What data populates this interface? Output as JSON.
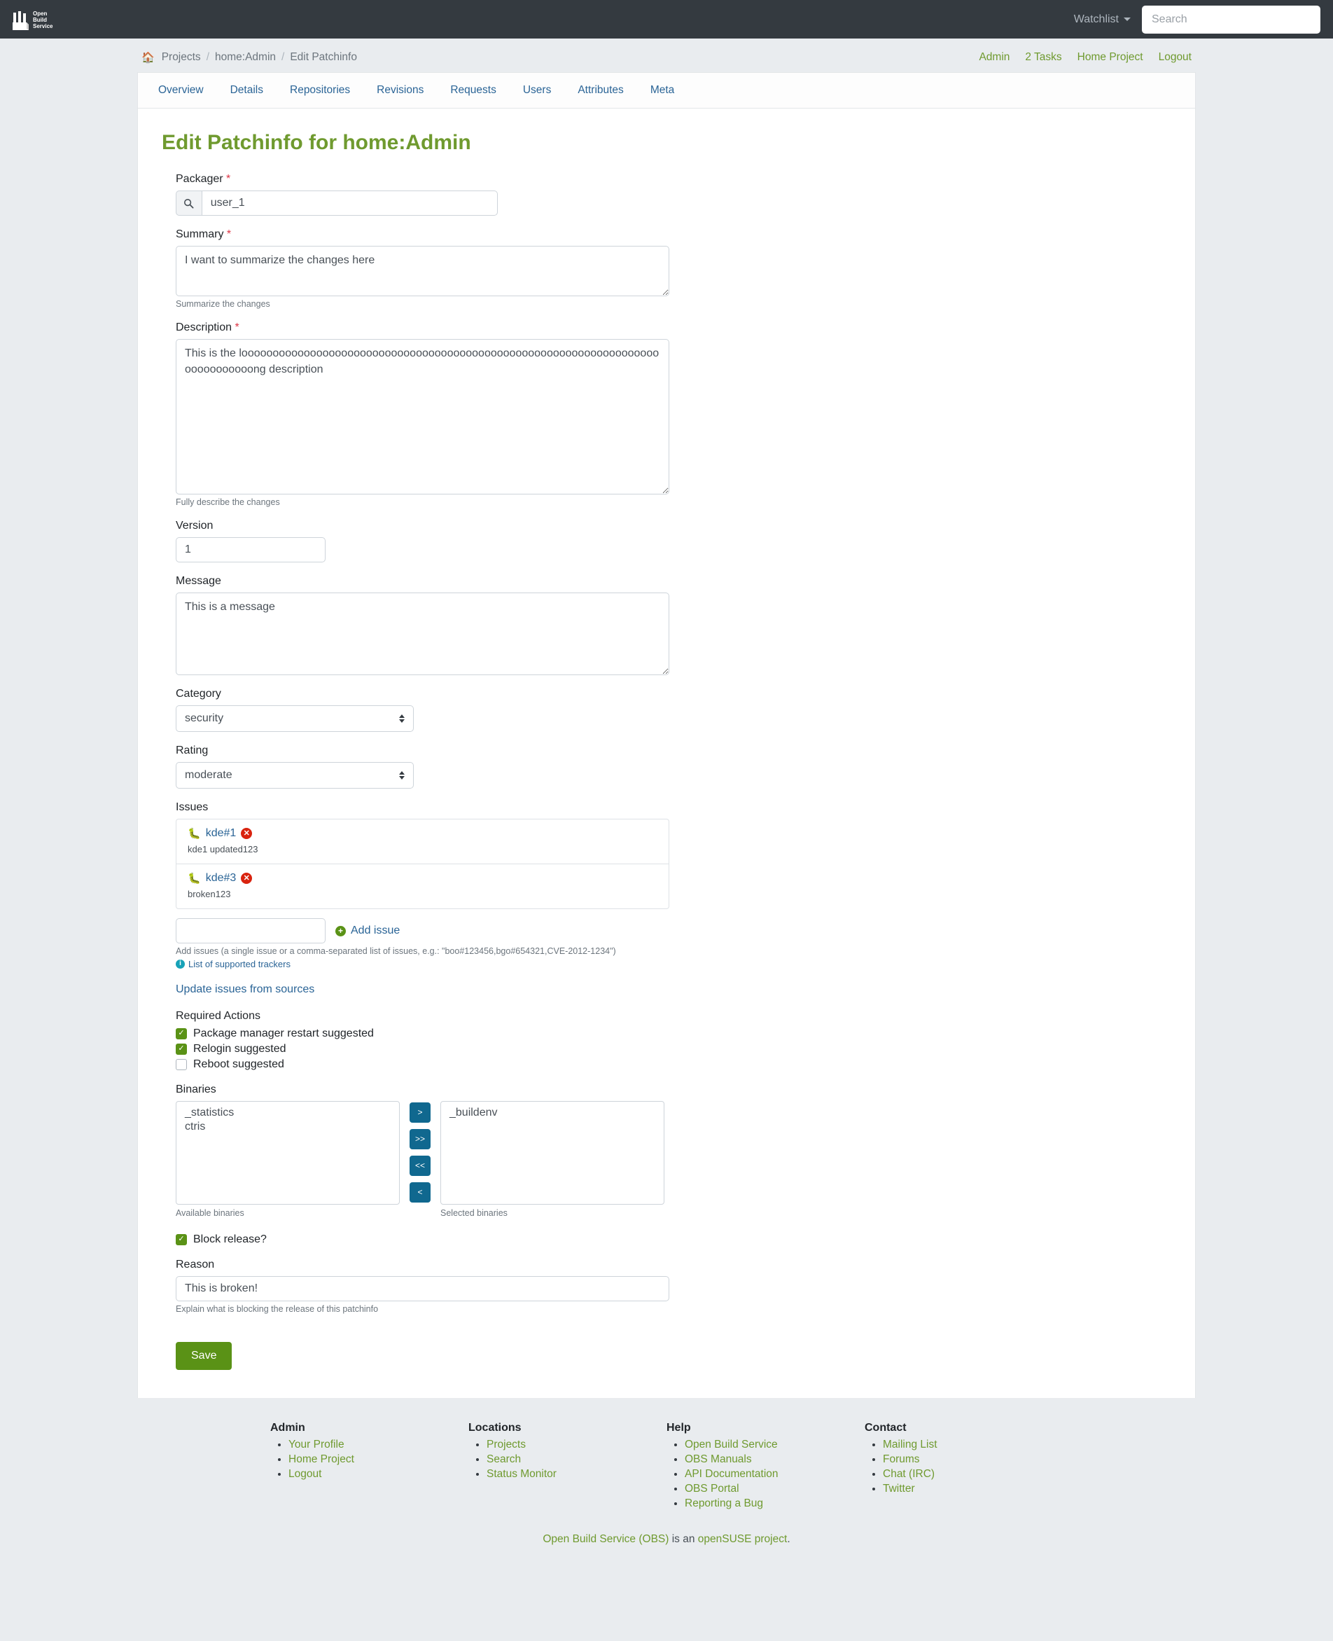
{
  "navbar": {
    "brand_name": "Open Build Service",
    "watchlist_label": "Watchlist",
    "search_placeholder": "Search",
    "search_value": "",
    "bg_color": "#343a40"
  },
  "breadcrumb": {
    "home_icon": "home-icon",
    "items": [
      "Projects",
      "home:Admin",
      "Edit Patchinfo"
    ],
    "separator": "/"
  },
  "top_links": [
    {
      "label": "Admin"
    },
    {
      "label": "2 Tasks"
    },
    {
      "label": "Home Project"
    },
    {
      "label": "Logout"
    }
  ],
  "tabs": [
    {
      "label": "Overview"
    },
    {
      "label": "Details"
    },
    {
      "label": "Repositories"
    },
    {
      "label": "Revisions"
    },
    {
      "label": "Requests"
    },
    {
      "label": "Users"
    },
    {
      "label": "Attributes"
    },
    {
      "label": "Meta"
    }
  ],
  "page_title": "Edit Patchinfo for home:Admin",
  "form": {
    "packager": {
      "label": "Packager",
      "required_mark": "*",
      "icon": "search-icon",
      "value": "user_1"
    },
    "summary": {
      "label": "Summary",
      "required_mark": "*",
      "value": "I want to summarize the changes here",
      "help": "Summarize the changes"
    },
    "description": {
      "label": "Description",
      "required_mark": "*",
      "value": "This is the loooooooooooooooooooooooooooooooooooooooooooooooooooooooooooooooooooooooooooooong description",
      "help": "Fully describe the changes"
    },
    "version": {
      "label": "Version",
      "value": "1"
    },
    "message": {
      "label": "Message",
      "value": "This is a message"
    },
    "category": {
      "label": "Category",
      "value": "security"
    },
    "rating": {
      "label": "Rating",
      "value": "moderate"
    },
    "issues": {
      "label": "Issues",
      "items": [
        {
          "icon": "bug-icon",
          "link": "kde#1",
          "delete_icon": "delete-icon",
          "description": "kde1 updated123"
        },
        {
          "icon": "bug-icon",
          "link": "kde#3",
          "delete_icon": "delete-icon",
          "description": "broken123"
        }
      ],
      "add_input_value": "",
      "add_label": "Add issue",
      "add_icon": "plus-circle-icon",
      "help": "Add issues (a single issue or a comma-separated list of issues, e.g.: \"boo#123456,bgo#654321,CVE-2012-1234\")",
      "trackers_link": "List of supported trackers",
      "trackers_icon": "info-icon",
      "update_link": "Update issues from sources"
    },
    "required_actions": {
      "label": "Required Actions",
      "items": [
        {
          "label": "Package manager restart suggested",
          "checked": true
        },
        {
          "label": "Relogin suggested",
          "checked": true
        },
        {
          "label": "Reboot suggested",
          "checked": false
        }
      ]
    },
    "binaries": {
      "label": "Binaries",
      "available": [
        "_statistics",
        "ctris"
      ],
      "selected": [
        "_buildenv"
      ],
      "available_help": "Available binaries",
      "selected_help": "Selected binaries",
      "buttons": [
        ">",
        ">>",
        "<<",
        "<"
      ]
    },
    "block_release": {
      "label": "Block release?",
      "checked": true
    },
    "reason": {
      "label": "Reason",
      "value": "This is broken!",
      "help": "Explain what is blocking the release of this patchinfo"
    },
    "save_label": "Save"
  },
  "footer": {
    "columns": [
      {
        "title": "Admin",
        "links": [
          "Your Profile",
          "Home Project",
          "Logout"
        ]
      },
      {
        "title": "Locations",
        "links": [
          "Projects",
          "Search",
          "Status Monitor"
        ]
      },
      {
        "title": "Help",
        "links": [
          "Open Build Service",
          "OBS Manuals",
          "API Documentation",
          "OBS Portal",
          "Reporting a Bug"
        ]
      },
      {
        "title": "Contact",
        "links": [
          "Mailing List",
          "Forums",
          "Chat (IRC)",
          "Twitter"
        ]
      }
    ],
    "bottom": {
      "link1": "Open Build Service (OBS)",
      "mid": " is an ",
      "link2": "openSUSE project",
      "end": "."
    }
  },
  "colors": {
    "brand_green": "#6f9a2f",
    "link_blue": "#2a6496",
    "danger_red": "#d9230f",
    "navbar_dark": "#343a40"
  }
}
